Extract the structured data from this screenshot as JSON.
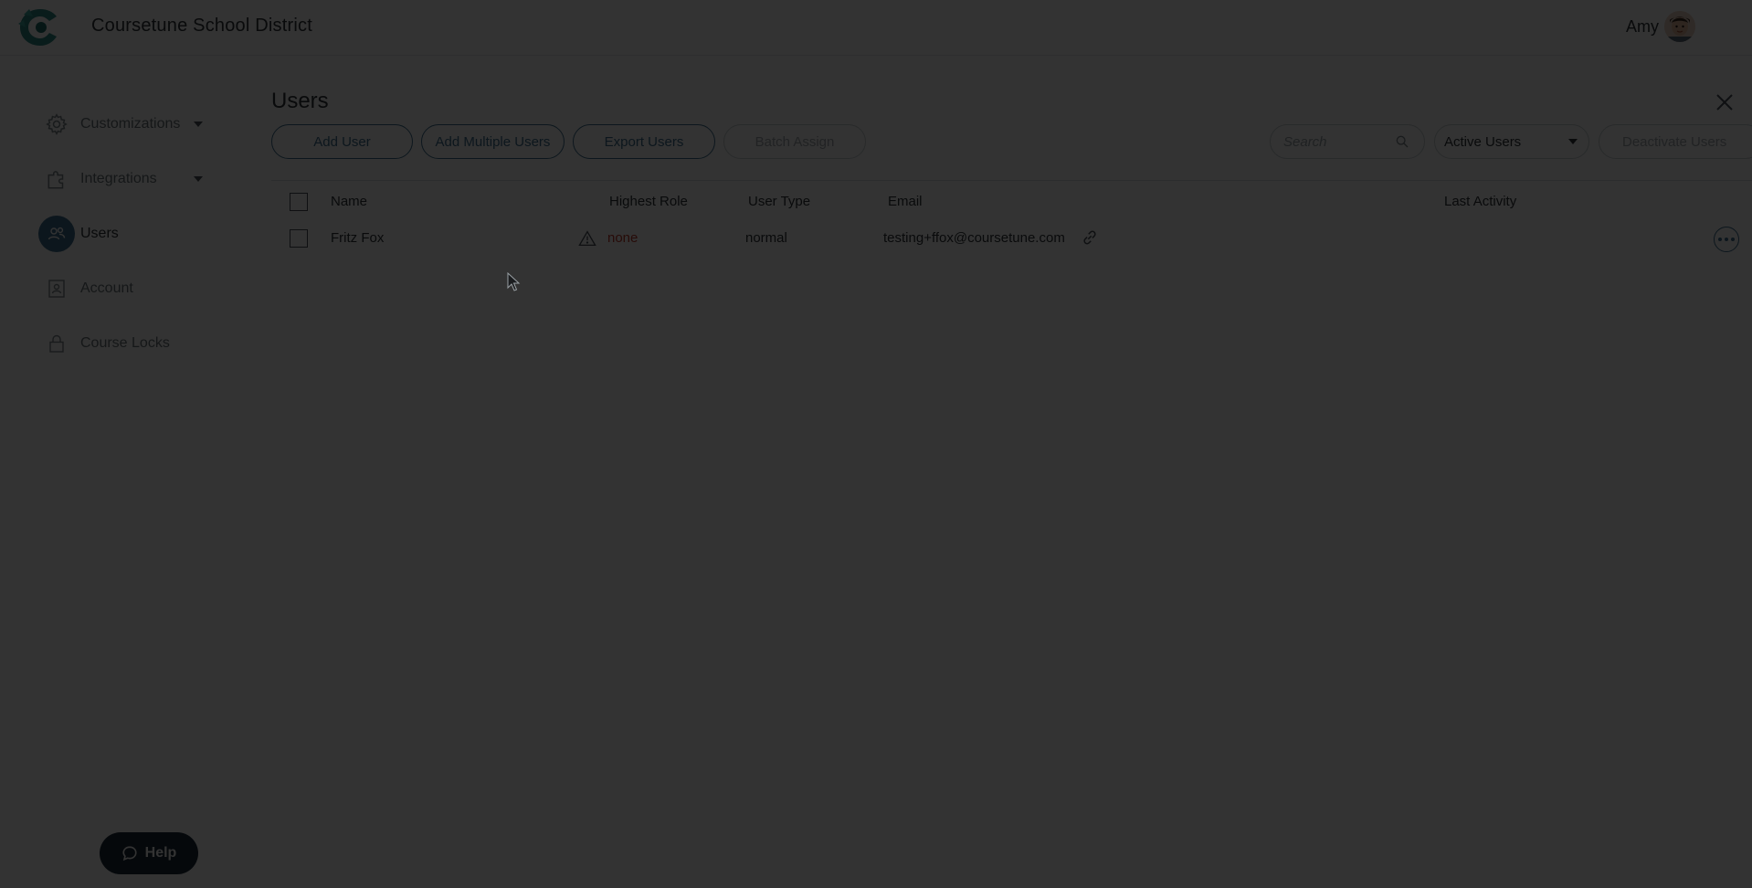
{
  "header": {
    "org_title": "Coursetune School District",
    "user_name": "Amy"
  },
  "sidebar": {
    "items": [
      {
        "label": "Customizations",
        "icon": "gear-icon",
        "has_caret": true,
        "active": false
      },
      {
        "label": "Integrations",
        "icon": "puzzle-icon",
        "has_caret": true,
        "active": false
      },
      {
        "label": "Users",
        "icon": "users-icon",
        "has_caret": false,
        "active": true
      },
      {
        "label": "Account",
        "icon": "account-icon",
        "has_caret": false,
        "active": false
      },
      {
        "label": "Course Locks",
        "icon": "lock-icon",
        "has_caret": false,
        "active": false
      }
    ]
  },
  "help": {
    "label": "Help"
  },
  "main": {
    "title": "Users",
    "toolbar": {
      "add_user": "Add User",
      "add_multiple_users": "Add Multiple Users",
      "export_users": "Export Users",
      "batch_assign": "Batch Assign",
      "search_placeholder": "Search",
      "filter_selected": "Active Users",
      "deactivate_users": "Deactivate Users"
    },
    "table": {
      "headers": {
        "name": "Name",
        "highest_role": "Highest Role",
        "user_type": "User Type",
        "email": "Email",
        "last_activity": "Last Activity"
      },
      "rows": [
        {
          "name": "Fritz Fox",
          "highest_role": "none",
          "user_type": "normal",
          "email": "testing+ffox@coursetune.com",
          "last_activity": ""
        }
      ]
    }
  },
  "colors": {
    "accent": "#3f6f8f",
    "warning_text": "#c0392b",
    "help_bg": "#1a2b39",
    "overlay": "rgba(0,0,0,0.8)"
  }
}
